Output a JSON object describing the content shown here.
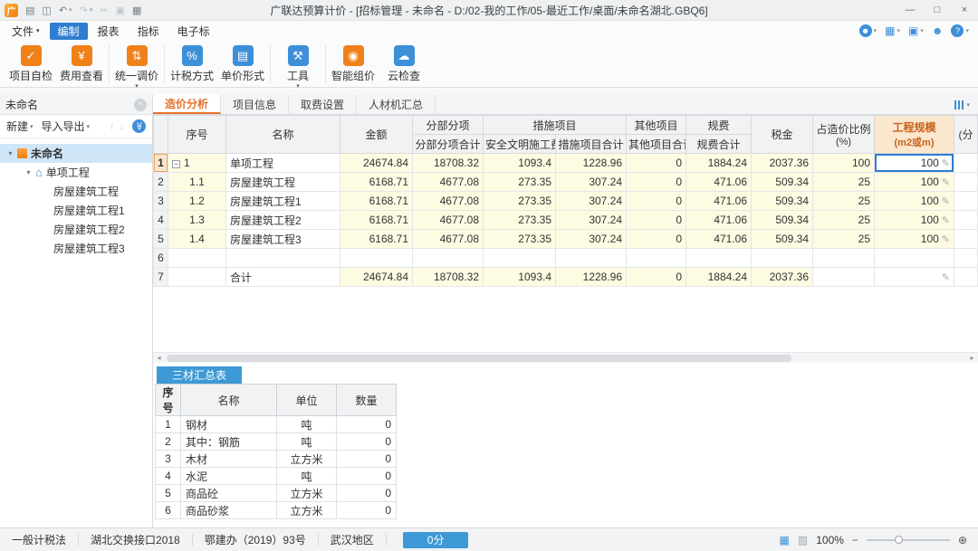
{
  "colors": {
    "accent_orange": "#e8702a",
    "accent_blue": "#3d8fd8",
    "cell_yellow": "#fdfbe2",
    "panel_tab_blue": "#3d9ad6"
  },
  "titlebar": {
    "logo_text": "广",
    "title": "广联达预算计价 - [招标管理 - 未命名 - D:/02-我的工作/05-最近工作/桌面/未命名湖北.GBQ6]",
    "quick_icons": [
      {
        "name": "menu-grid-icon",
        "glyph": "▤",
        "disabled": false,
        "caret": false
      },
      {
        "name": "save-icon",
        "glyph": "◫",
        "disabled": false,
        "caret": false
      },
      {
        "name": "undo-icon",
        "glyph": "↶",
        "disabled": false,
        "caret": true
      },
      {
        "name": "redo-icon",
        "glyph": "↷",
        "disabled": true,
        "caret": true
      },
      {
        "name": "cut-icon",
        "glyph": "✂",
        "disabled": true,
        "caret": false
      },
      {
        "name": "copy-icon",
        "glyph": "▣",
        "disabled": true,
        "caret": false
      },
      {
        "name": "paste-icon",
        "glyph": "▦",
        "disabled": false,
        "caret": false
      }
    ],
    "window_controls": {
      "minimize": "—",
      "maximize": "□",
      "close": "×"
    }
  },
  "menubar": {
    "items": [
      {
        "label": "文件",
        "caret": true,
        "active": false
      },
      {
        "label": "编制",
        "caret": false,
        "active": true
      },
      {
        "label": "报表",
        "caret": false,
        "active": false
      },
      {
        "label": "指标",
        "caret": false,
        "active": false
      },
      {
        "label": "电子标",
        "caret": false,
        "active": false
      }
    ],
    "right_icons": [
      {
        "name": "account-icon",
        "glyph": "☻",
        "circle": true,
        "caret": true
      },
      {
        "name": "apps-grid-icon",
        "glyph": "▦",
        "circle": false,
        "caret": true
      },
      {
        "name": "package-icon",
        "glyph": "▣",
        "circle": false,
        "caret": true
      },
      {
        "name": "user-icon",
        "glyph": "☻",
        "circle": false,
        "caret": false
      },
      {
        "name": "help-icon",
        "glyph": "?",
        "circle": true,
        "caret": true
      }
    ]
  },
  "ribbon": {
    "buttons": [
      {
        "name": "project-self-check-button",
        "icon": "check-document-icon",
        "label": "项目自检",
        "glyph": "✓",
        "color": "#f08119",
        "caret": false,
        "sep_after": false
      },
      {
        "name": "fee-view-button",
        "icon": "fee-table-icon",
        "label": "费用查看",
        "glyph": "¥",
        "color": "#f08119",
        "caret": false,
        "sep_after": true
      },
      {
        "name": "unify-price-button",
        "icon": "adjust-price-icon",
        "label": "统一调价",
        "glyph": "⇅",
        "color": "#f08119",
        "caret": true,
        "sep_after": true
      },
      {
        "name": "tax-method-button",
        "icon": "tax-calculator-icon",
        "label": "计税方式",
        "glyph": "%",
        "color": "#3d8fd8",
        "caret": false,
        "sep_after": false
      },
      {
        "name": "unit-price-form-button",
        "icon": "price-form-icon",
        "label": "单价形式",
        "glyph": "▤",
        "color": "#3d8fd8",
        "caret": false,
        "sep_after": true
      },
      {
        "name": "tools-button",
        "icon": "toolbox-icon",
        "label": "工具",
        "glyph": "⚒",
        "color": "#3d8fd8",
        "caret": true,
        "sep_after": true
      },
      {
        "name": "smart-pricing-button",
        "icon": "smart-pricing-icon",
        "label": "智能组价",
        "glyph": "◉",
        "color": "#f08119",
        "caret": false,
        "sep_after": false
      },
      {
        "name": "cloud-check-button",
        "icon": "cloud-icon",
        "label": "云检查",
        "glyph": "☁",
        "color": "#3d8fd8",
        "caret": false,
        "sep_after": false
      }
    ]
  },
  "sidebar": {
    "header": "未命名",
    "toolbar": {
      "new_label": "新建",
      "import_export_label": "导入导出"
    },
    "tree": [
      {
        "label": "未命名",
        "level": 0,
        "icon": "building",
        "expander": true,
        "selected": true,
        "bold": true
      },
      {
        "label": "单项工程",
        "level": 1,
        "icon": "house",
        "expander": true,
        "selected": false,
        "bold": false
      },
      {
        "label": "房屋建筑工程",
        "level": 2,
        "icon": null,
        "expander": false,
        "selected": false,
        "bold": false
      },
      {
        "label": "房屋建筑工程1",
        "level": 2,
        "icon": null,
        "expander": false,
        "selected": false,
        "bold": false
      },
      {
        "label": "房屋建筑工程2",
        "level": 2,
        "icon": null,
        "expander": false,
        "selected": false,
        "bold": false
      },
      {
        "label": "房屋建筑工程3",
        "level": 2,
        "icon": null,
        "expander": false,
        "selected": false,
        "bold": false
      }
    ]
  },
  "main_tabs": [
    {
      "label": "造价分析",
      "active": true
    },
    {
      "label": "项目信息",
      "active": false
    },
    {
      "label": "取费设置",
      "active": false
    },
    {
      "label": "人材机汇总",
      "active": false
    }
  ],
  "main_table": {
    "header": {
      "seq": "序号",
      "name": "名称",
      "amount": "金额",
      "fbfx_group": "分部分项",
      "fbfx_sub": "分部分项合计",
      "csxm_group": "措施项目",
      "csxm_sub1": "安全文明施工费",
      "csxm_sub2": "措施项目合计",
      "qtxm_group": "其他项目",
      "qtxm_sub": "其他项目合计",
      "gf_group": "规费",
      "gf_sub": "规费合计",
      "sj": "税金",
      "ratio_line1": "占造价比例",
      "ratio_line2": "(%)",
      "scale_line1": "工程规模",
      "scale_line2": "(m2或m)",
      "partial": "(分"
    },
    "rows": [
      {
        "idx": "1",
        "seq": "1",
        "expander": true,
        "name": "单项工程",
        "amount": "24674.84",
        "fbfx": "18708.32",
        "aqwm": "1093.4",
        "csxm": "1228.96",
        "qtxm": "0",
        "gf": "1884.24",
        "sj": "2037.36",
        "ratio": "100",
        "scale": "100",
        "last": "",
        "kind": "data",
        "pencil": true,
        "selected_cell": "scale",
        "current": true
      },
      {
        "idx": "2",
        "seq": "1.1",
        "expander": false,
        "name": "房屋建筑工程",
        "amount": "6168.71",
        "fbfx": "4677.08",
        "aqwm": "273.35",
        "csxm": "307.24",
        "qtxm": "0",
        "gf": "471.06",
        "sj": "509.34",
        "ratio": "25",
        "scale": "100",
        "last": "",
        "kind": "data",
        "pencil": true
      },
      {
        "idx": "3",
        "seq": "1.2",
        "expander": false,
        "name": "房屋建筑工程1",
        "amount": "6168.71",
        "fbfx": "4677.08",
        "aqwm": "273.35",
        "csxm": "307.24",
        "qtxm": "0",
        "gf": "471.06",
        "sj": "509.34",
        "ratio": "25",
        "scale": "100",
        "last": "",
        "kind": "data",
        "pencil": true
      },
      {
        "idx": "4",
        "seq": "1.3",
        "expander": false,
        "name": "房屋建筑工程2",
        "amount": "6168.71",
        "fbfx": "4677.08",
        "aqwm": "273.35",
        "csxm": "307.24",
        "qtxm": "0",
        "gf": "471.06",
        "sj": "509.34",
        "ratio": "25",
        "scale": "100",
        "last": "",
        "kind": "data",
        "pencil": true
      },
      {
        "idx": "5",
        "seq": "1.4",
        "expander": false,
        "name": "房屋建筑工程3",
        "amount": "6168.71",
        "fbfx": "4677.08",
        "aqwm": "273.35",
        "csxm": "307.24",
        "qtxm": "0",
        "gf": "471.06",
        "sj": "509.34",
        "ratio": "25",
        "scale": "100",
        "last": "",
        "kind": "data",
        "pencil": true
      },
      {
        "idx": "6",
        "seq": "",
        "expander": false,
        "name": "",
        "amount": "",
        "fbfx": "",
        "aqwm": "",
        "csxm": "",
        "qtxm": "",
        "gf": "",
        "sj": "",
        "ratio": "",
        "scale": "",
        "last": "",
        "kind": "empty",
        "pencil": false
      },
      {
        "idx": "7",
        "seq": "",
        "expander": false,
        "name": "合计",
        "amount": "24674.84",
        "fbfx": "18708.32",
        "aqwm": "1093.4",
        "csxm": "1228.96",
        "qtxm": "0",
        "gf": "1884.24",
        "sj": "2037.36",
        "ratio": "",
        "scale": "",
        "last": "",
        "kind": "total",
        "pencil": true
      }
    ]
  },
  "bottom_panel": {
    "tab": "三材汇总表",
    "table": {
      "headers": [
        "序号",
        "名称",
        "单位",
        "数量"
      ],
      "rows": [
        [
          "1",
          "钢材",
          "吨",
          "0"
        ],
        [
          "2",
          "其中：钢筋",
          "吨",
          "0"
        ],
        [
          "3",
          "木材",
          "立方米",
          "0"
        ],
        [
          "4",
          "水泥",
          "吨",
          "0"
        ],
        [
          "5",
          "商品砼",
          "立方米",
          "0"
        ],
        [
          "6",
          "商品砂浆",
          "立方米",
          "0"
        ]
      ]
    }
  },
  "statusbar": {
    "items": [
      "一般计税法",
      "湖北交换接口2018",
      "鄂建办（2019）93号",
      "武汉地区"
    ],
    "score": "0分",
    "zoom": "100%"
  }
}
